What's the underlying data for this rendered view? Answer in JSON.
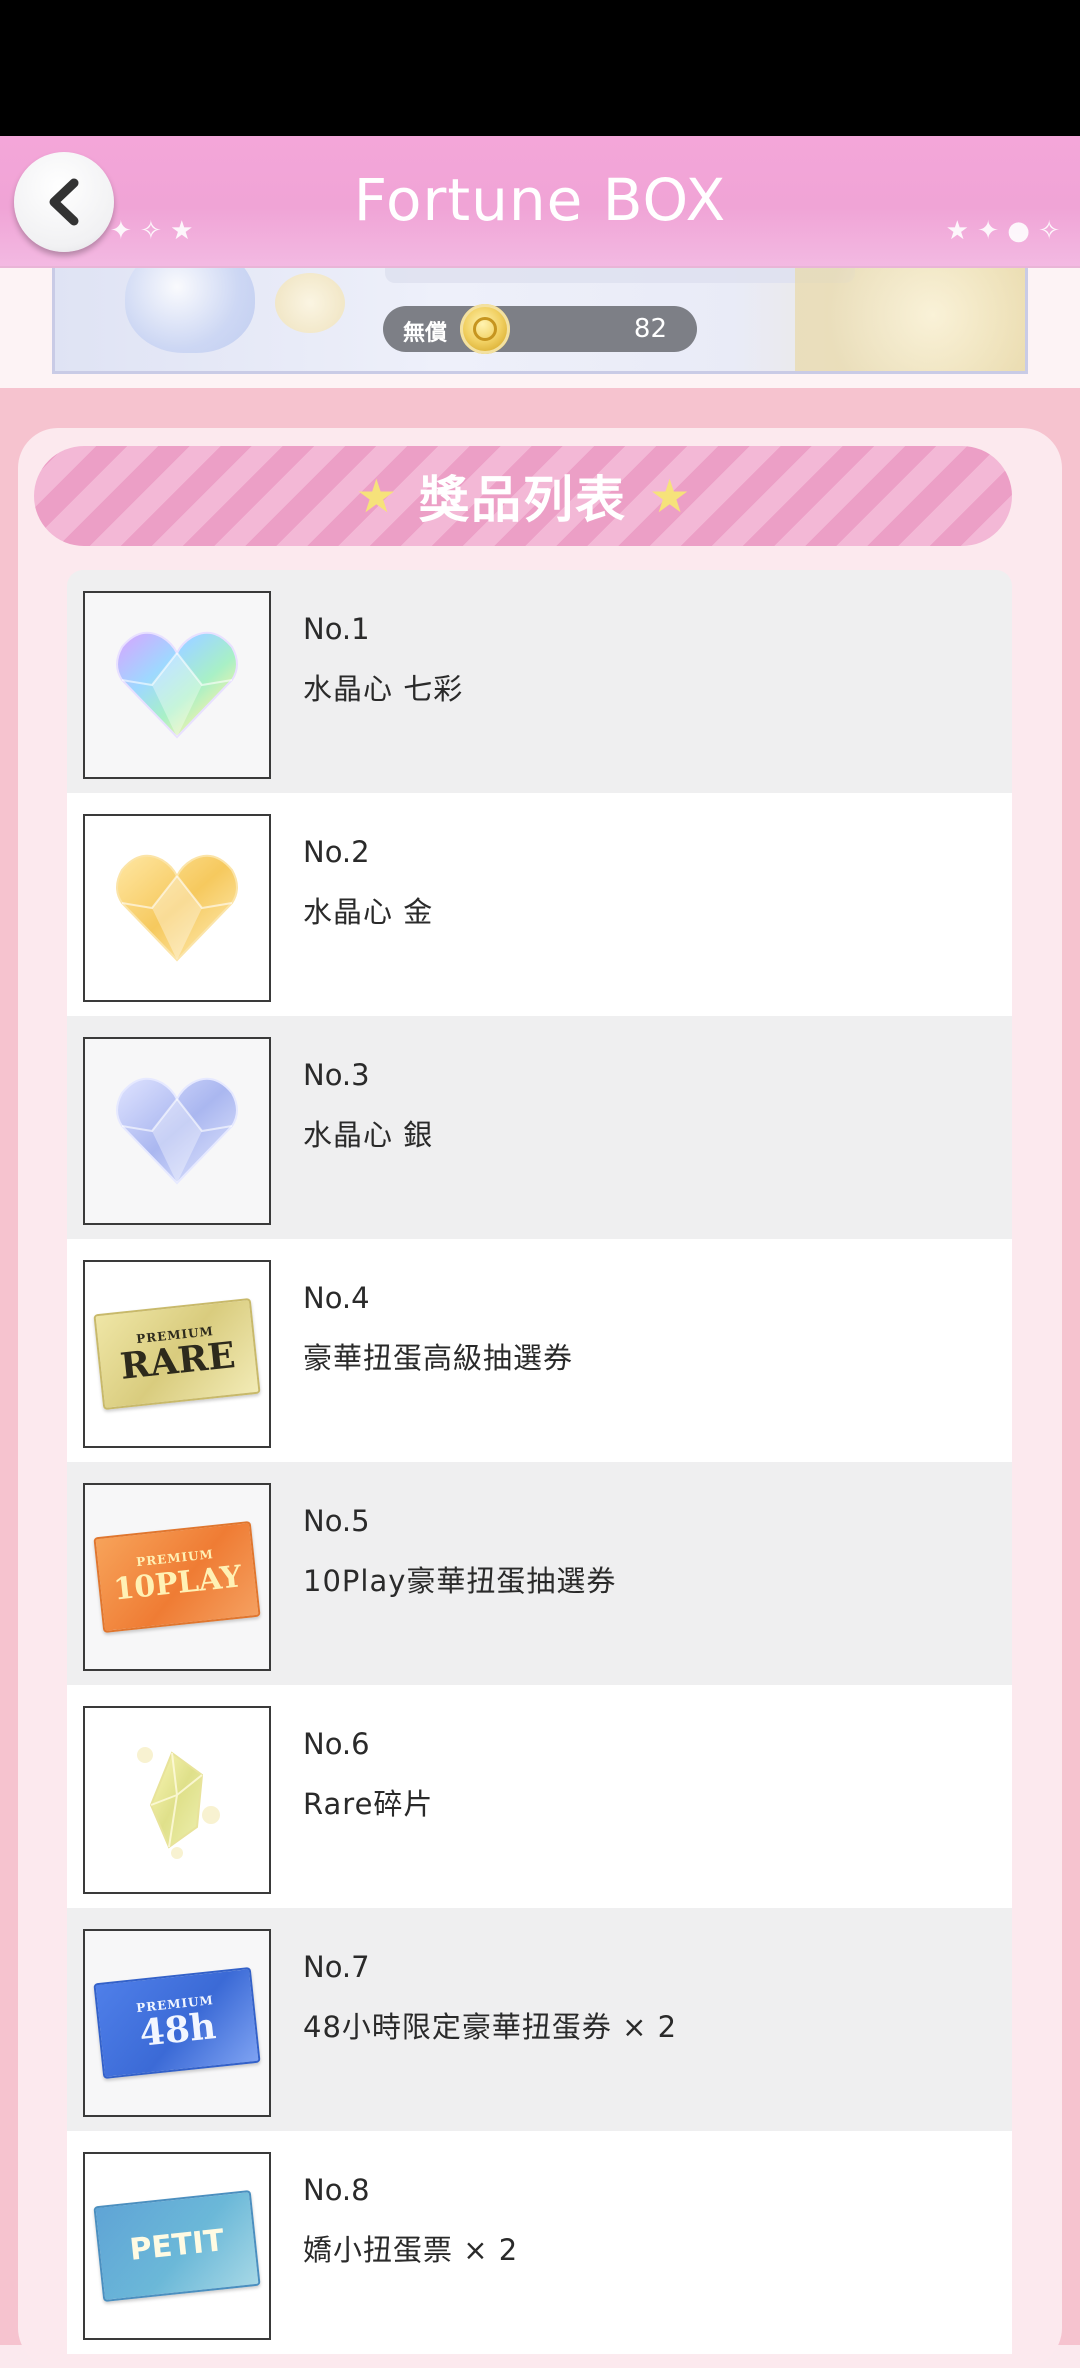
{
  "header": {
    "title": "Fortune BOX",
    "back_icon": "chevron-left-icon"
  },
  "banner": {
    "coin_label": "無償",
    "coin_count": "82",
    "coin_icon": "coin-icon"
  },
  "prize_section": {
    "title": "獎品列表"
  },
  "prizes": [
    {
      "no": "No.1",
      "name": "水晶心 七彩",
      "icon": "rainbow-crystal-heart-icon"
    },
    {
      "no": "No.2",
      "name": "水晶心 金",
      "icon": "gold-crystal-heart-icon"
    },
    {
      "no": "No.3",
      "name": "水晶心 銀",
      "icon": "silver-crystal-heart-icon"
    },
    {
      "no": "No.4",
      "name": "豪華扭蛋高級抽選券",
      "icon": "premium-rare-ticket-icon",
      "ticket_text": "RARE",
      "ticket_small": "PREMIUM"
    },
    {
      "no": "No.5",
      "name": "10Play豪華扭蛋抽選券",
      "icon": "premium-10play-ticket-icon",
      "ticket_text": "10PLAY",
      "ticket_small": "PREMIUM"
    },
    {
      "no": "No.6",
      "name": "Rare碎片",
      "icon": "rare-shard-icon"
    },
    {
      "no": "No.7",
      "name": "48小時限定豪華扭蛋券 × 2",
      "icon": "premium-48h-ticket-icon",
      "ticket_text": "48h",
      "ticket_small": "PREMIUM"
    },
    {
      "no": "No.8",
      "name": "嬌小扭蛋票 × 2",
      "icon": "petit-ticket-icon",
      "ticket_text": "PETIT"
    }
  ],
  "colors": {
    "header_pink": "#f0a4d6",
    "ribbon_pink": "#ec9fc6",
    "panel_bg": "#fce9ee",
    "row_alt": "#efeff0"
  }
}
